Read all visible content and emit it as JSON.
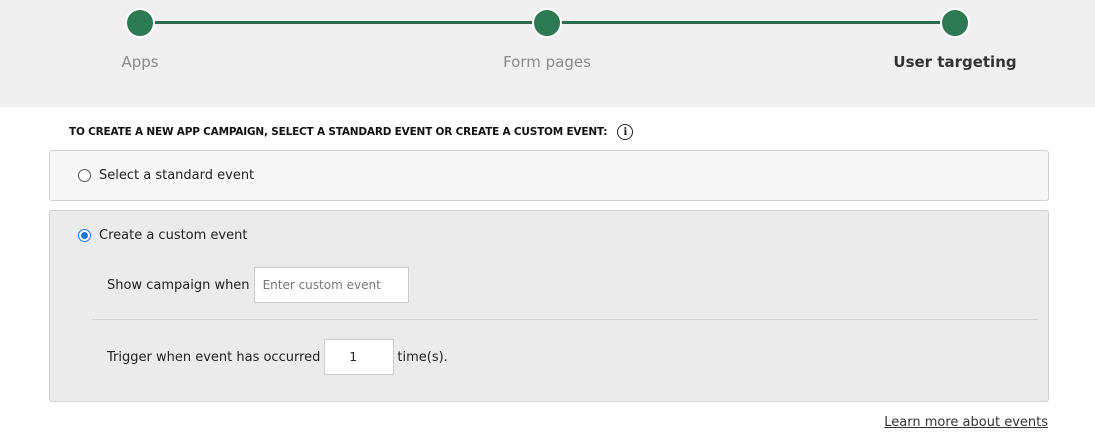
{
  "stepper": {
    "steps": [
      {
        "label": "Apps",
        "active": false
      },
      {
        "label": "Form pages",
        "active": false
      },
      {
        "label": "User targeting",
        "active": true
      }
    ],
    "accent_color": "#2e7a56"
  },
  "heading": {
    "text": "TO CREATE A NEW APP CAMPAIGN, SELECT A STANDARD EVENT OR CREATE A CUSTOM EVENT:",
    "info_icon": "i"
  },
  "options": {
    "standard": {
      "label": "Select a standard event",
      "selected": false
    },
    "custom": {
      "label": "Create a custom event",
      "selected": true
    }
  },
  "custom_event": {
    "show_label": "Show campaign when",
    "event_placeholder": "Enter custom event",
    "event_value": "",
    "trigger_label": "Trigger when event has occurred",
    "trigger_value": "1",
    "trigger_suffix": "time(s)."
  },
  "footer": {
    "learn_more": "Learn more about events"
  }
}
